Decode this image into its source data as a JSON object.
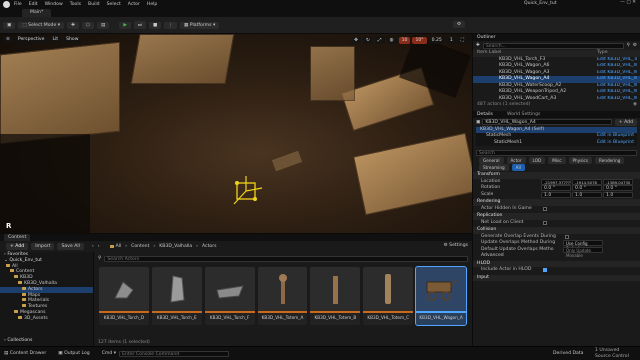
{
  "window": {
    "title": "Quick_Env_tut",
    "menu": [
      "File",
      "Edit",
      "Window",
      "Tools",
      "Build",
      "Select",
      "Actor",
      "Help"
    ],
    "level_tab": "Main*"
  },
  "toolbar": {
    "mode": "Select Mode",
    "platforms": "Platforms"
  },
  "viewport": {
    "perspective": "Perspective",
    "lit": "Lit",
    "grid": "10",
    "angle": "10°",
    "scale": "0.25",
    "speed": "1",
    "gizmo_label": "R"
  },
  "outliner": {
    "title": "Outliner",
    "search_placeholder": "Search...",
    "col_item": "Item Label",
    "col_type": "Type",
    "rows": [
      {
        "label": "KB3D_VHL_Torch_F3",
        "type": "Edit KB3D_VHL_Tor"
      },
      {
        "label": "KB3D_VHL_Wagon_A6",
        "type": "Edit KB3D_VHL_Wa"
      },
      {
        "label": "KB3D_VHL_Wagon_A3",
        "type": "Edit KB3D_VHL_Wa"
      },
      {
        "label": "KB3D_VHL_Wagon_A4",
        "type": "Edit KB3D_VHL_Wa",
        "selected": true
      },
      {
        "label": "KB3D_VHL_WaterScoop_A2",
        "type": "Edit KB3D_VHL_Wa"
      },
      {
        "label": "KB3D_VHL_WeaponTripod_A2",
        "type": "Edit KB3D_VHL_We"
      },
      {
        "label": "KB3D_VHL_WoodCart_A3",
        "type": "Edit KB3D_VHL_Wo"
      }
    ],
    "footer": "487 actors (1 selected)"
  },
  "details": {
    "tab": "Details",
    "world_tab": "World Settings",
    "actor_name": "KB3D_VHL_Wagon_A4",
    "add_label": "+ Add",
    "components": [
      {
        "label": "KB3D_VHL_Wagon_A4 (Self)"
      },
      {
        "label": "StaticMesh",
        "link": "Edit in Blueprint"
      },
      {
        "label": "StaticMesh1",
        "link": "Edit in Blueprint"
      }
    ],
    "search_placeholder": "Search",
    "filter_tabs": [
      "General",
      "Actor",
      "LOD",
      "Misc",
      "Physics",
      "Rendering"
    ],
    "filter_tabs2": [
      "Streaming",
      "All"
    ],
    "transform": {
      "header": "Transform",
      "location_label": "Location",
      "rotation_label": "Rotation",
      "scale_label": "Scale",
      "location": [
        "-21997.377??",
        "-1914.5078",
        "-1389.04730"
      ],
      "rotation": [
        "0.0 °",
        "0.0 °",
        "0.0 °"
      ],
      "scale": [
        "1.0",
        "1.0",
        "1.0"
      ]
    },
    "rendering": {
      "header": "Rendering",
      "prop": "Actor Hidden In Game"
    },
    "replication": {
      "header": "Replication",
      "prop": "Net Load on Client"
    },
    "collision": {
      "header": "Collision",
      "props": [
        {
          "label": "Generate Overlap Events During",
          "value": ""
        },
        {
          "label": "Update Overlaps Method During",
          "value": "Use Config Default"
        },
        {
          "label": "Default Update Overlaps Metho",
          "value": "Only Update Movable"
        }
      ]
    },
    "advanced": "Advanced",
    "hlod": {
      "header": "HLOD",
      "prop": "Include Actor in HLOD"
    },
    "input": "Input"
  },
  "content_browser": {
    "tab": "Content",
    "add_label": "+ Add",
    "import_label": "Import",
    "save_label": "Save All",
    "path": [
      "All",
      "Content",
      "KB3D_Valhalla",
      "Actors"
    ],
    "settings": "Settings",
    "search_placeholder": "Search Actors",
    "favorites": "Favorites",
    "project": "Quick_Env_tut",
    "tree": [
      {
        "label": "All",
        "level": 0
      },
      {
        "label": "Content",
        "level": 1
      },
      {
        "label": "KB3D",
        "level": 2
      },
      {
        "label": "KB3D_Valhalla",
        "level": 3
      },
      {
        "label": "Actors",
        "level": 4,
        "selected": true
      },
      {
        "label": "Maps",
        "level": 4
      },
      {
        "label": "Materials",
        "level": 4
      },
      {
        "label": "Textures",
        "level": 4
      },
      {
        "label": "Megascans",
        "level": 2
      },
      {
        "label": "3D_Assets",
        "level": 3
      }
    ],
    "collections": "Collections",
    "tiles": [
      {
        "name": "KB3D_VHL_Torch_D"
      },
      {
        "name": "KB3D_VHL_Torch_E"
      },
      {
        "name": "KB3D_VHL_Torch_F"
      },
      {
        "name": "KB3D_VHL_Totem_A"
      },
      {
        "name": "KB3D_VHL_Totem_B"
      },
      {
        "name": "KB3D_VHL_Totem_C"
      },
      {
        "name": "KB3D_VHL_Wagon_A",
        "selected": true
      }
    ],
    "footer": "127 items (1 selected)"
  },
  "statusbar": {
    "content_drawer": "Content Drawer",
    "output_log": "Output Log",
    "cmd": "Cmd",
    "console_placeholder": "Enter Console Command",
    "derived": "Derived Data",
    "unsaved": "1 Unsaved",
    "source": "Source Control"
  },
  "colors": {
    "accent": "#4fa6ff",
    "play": "#4cba4c",
    "folder": "#c9a14b"
  }
}
